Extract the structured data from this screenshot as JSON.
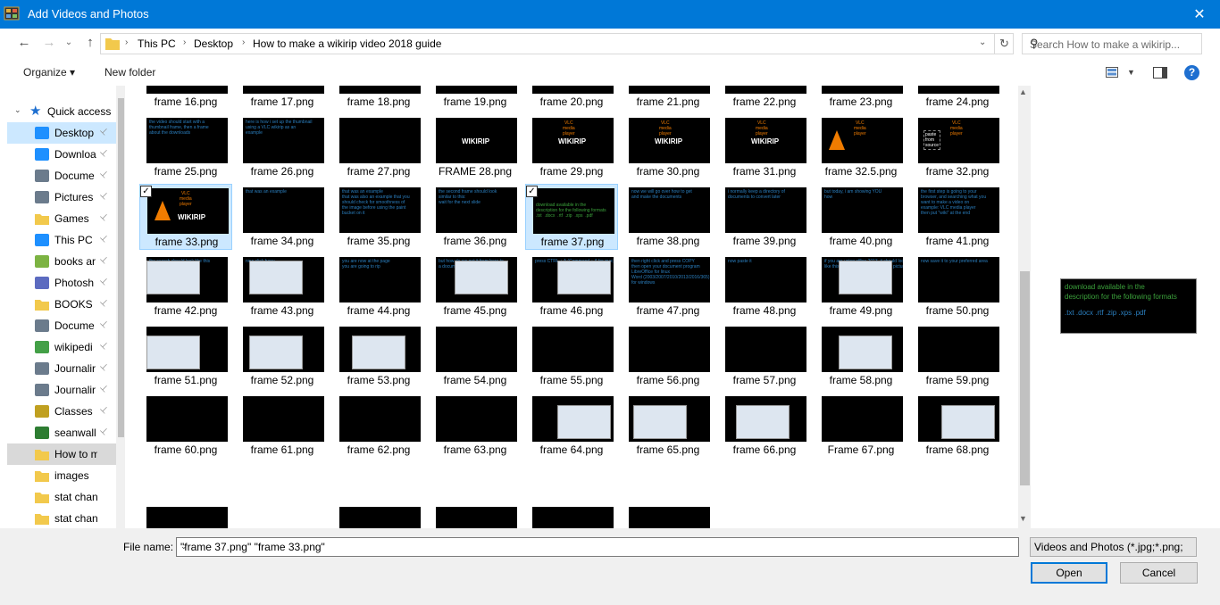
{
  "window": {
    "title": "Add Videos and Photos",
    "close_glyph": "✕"
  },
  "nav": {
    "back": "←",
    "forward": "→",
    "up": "↑",
    "dropdown": "⌄"
  },
  "address": {
    "crumbs": [
      "This PC",
      "Desktop",
      "How to make a wikirip video 2018 guide"
    ],
    "separator": "›",
    "dropdown": "⌄",
    "refresh": "↻"
  },
  "search": {
    "placeholder": "Search How to make a wikirip...",
    "icon": "search-icon",
    "glyph": "⚲"
  },
  "toolbar": {
    "organize": "Organize ▾",
    "new_folder": "New folder",
    "help": "?"
  },
  "sidebar": {
    "quick_access": "Quick access",
    "items": [
      {
        "label": "Desktop",
        "icon": "desktop-icon",
        "color": "#1e90ff"
      },
      {
        "label": "Downloa",
        "icon": "download-icon",
        "color": "#1e90ff"
      },
      {
        "label": "Docume",
        "icon": "documents-icon",
        "color": "#6b7b8c"
      },
      {
        "label": "Pictures",
        "icon": "pictures-icon",
        "color": "#6b7b8c"
      },
      {
        "label": "Games",
        "icon": "folder-icon",
        "color": "#f2c94c"
      },
      {
        "label": "This PC",
        "icon": "computer-icon",
        "color": "#1e90ff"
      },
      {
        "label": "books ar",
        "icon": "app-icon",
        "color": "#7cb342"
      },
      {
        "label": "Photosh",
        "icon": "app-icon",
        "color": "#5c6bc0"
      },
      {
        "label": "BOOKS",
        "icon": "folder-icon",
        "color": "#f2c94c"
      },
      {
        "label": "Docume",
        "icon": "documents-icon",
        "color": "#6b7b8c"
      },
      {
        "label": "wikipedi",
        "icon": "app-icon",
        "color": "#43a047"
      },
      {
        "label": "Journalir",
        "icon": "document-icon",
        "color": "#6b7b8c"
      },
      {
        "label": "Journalir",
        "icon": "document-icon",
        "color": "#6b7b8c"
      },
      {
        "label": "Classes",
        "icon": "app-icon",
        "color": "#c0a020"
      },
      {
        "label": "seanwall",
        "icon": "tree-icon",
        "color": "#2e7d32"
      },
      {
        "label": "How to mak",
        "icon": "folder-icon",
        "color": "#f2c94c"
      },
      {
        "label": "images",
        "icon": "folder-icon",
        "color": "#f2c94c"
      },
      {
        "label": "stat channe",
        "icon": "folder-icon",
        "color": "#f2c94c"
      },
      {
        "label": "stat channe",
        "icon": "folder-icon",
        "color": "#f2c94c"
      }
    ],
    "pin_glyph": "📌"
  },
  "files": [
    [
      "frame 16.png",
      "frame 17.png",
      "frame 18.png",
      "frame 19.png",
      "frame 20.png",
      "frame 21.png",
      "frame 22.png",
      "frame 23.png",
      "frame 24.png"
    ],
    [
      "frame 25.png",
      "frame 26.png",
      "frame 27.png",
      "FRAME 28.png",
      "frame 29.png",
      "frame 30.png",
      "frame 31.png",
      "frame 32.5.png",
      "frame 32.png"
    ],
    [
      "frame 33.png",
      "frame 34.png",
      "frame 35.png",
      "frame 36.png",
      "frame 37.png",
      "frame 38.png",
      "frame 39.png",
      "frame 40.png",
      "frame 41.png"
    ],
    [
      "frame 42.png",
      "frame 43.png",
      "frame 44.png",
      "frame 45.png",
      "frame 46.png",
      "frame 47.png",
      "frame 48.png",
      "frame 49.png",
      "frame 50.png"
    ],
    [
      "frame 51.png",
      "frame 52.png",
      "frame 53.png",
      "frame 54.png",
      "frame 55.png",
      "frame 56.png",
      "frame 57.png",
      "frame 58.png",
      "frame 59.png"
    ],
    [
      "frame 60.png",
      "frame 61.png",
      "frame 62.png",
      "frame 63.png",
      "frame 64.png",
      "frame 65.png",
      "frame 66.png",
      "Frame 67.png",
      "frame 68.png"
    ]
  ],
  "thumb_text": {
    "wikirip": "WIKIRIP",
    "vlc": "VLC\nmedia\nplayer",
    "paste": "paste\nfrom\nsource",
    "r1c0": "the video should start with a\nthumbnail frame, then a frame\nabout the downloads",
    "r1c1": "here is how i set up the thumbnail\nusing a VLC wikirip as an\nexample",
    "r2c1": "that was an example",
    "r2c2": "that was an example\nthat was also an example that you\nshould check for smoothness of\nthe image before using the paint\nbucket on it",
    "r2c3": "the second frame should look\nsimilar to this:\nwait for the next slide",
    "r2c4": "download available in the\ndescription for the following formats\n.txt  .docx  .rtf  .zip  .xps  .pdf",
    "r2c5": "now we will go over how to get\nand make the documents",
    "r2c6": "i normally keep a directory of\ndocuments to convert later",
    "r2c7": "but today, i am showing YOU\nhow",
    "r2c8": "the first step is going to your\nbrowser, and searching what you\nwant to make a video on\nexample: VLC media player\nthen put \"wiki\" at the end",
    "r3c0": "the search should look like this",
    "r3c1": "now click here:",
    "r3c2": "you are now at the page\nyou are going to rip",
    "r3c3": "but how do we get it from here to\na document on our desktops?",
    "r3c4": "press CTRL + A (Command + A for mac)",
    "r3c5": "then right click and press COPY\nthen open your document program\nLibreOffice for linux\nWord (2003/2007/2010/2013/2016/365)\nfor windows",
    "r3c6": "now paste it",
    "r3c7": "if you are using office 2013, it should look\nlike this (possibly not including the pictures)",
    "r3c8": "now save it to your preferred area"
  },
  "preview": {
    "line1": "download available in the",
    "line2": "description for the following formats",
    "line3": ".txt  .docx  .rtf  .zip  .xps  .pdf"
  },
  "footer": {
    "file_name_label": "File name:",
    "file_name_value": "\"frame 37.png\" \"frame 33.png\"",
    "file_type": "Videos and Photos (*.jpg;*.png;",
    "open": "Open",
    "cancel": "Cancel"
  }
}
